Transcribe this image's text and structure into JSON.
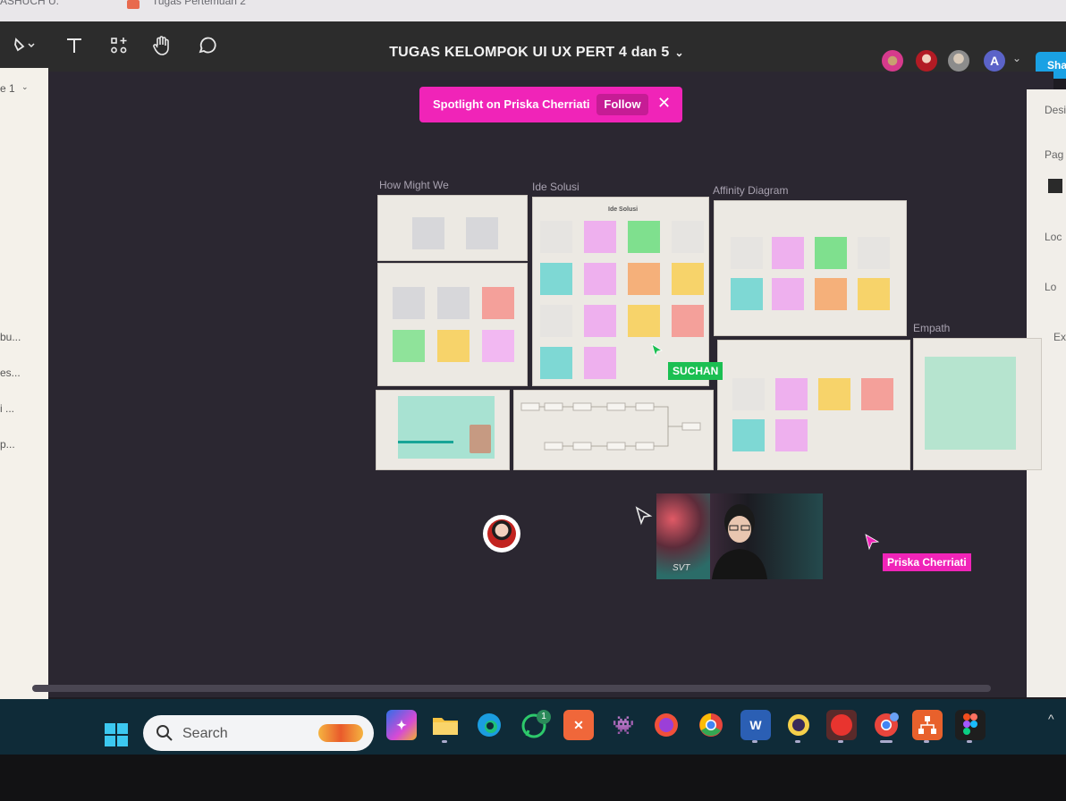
{
  "browser": {
    "tab_1": "ASHUCH U.",
    "tab_2": "Tugas Pertemuan 2"
  },
  "toolbar": {
    "file_title": "TUGAS KELOMPOK UI UX PERT 4 dan 5",
    "share_label": "Sha"
  },
  "left_panel": {
    "page_label": "e 1",
    "items": [
      "bu...",
      "es...",
      "i ...",
      "p..."
    ]
  },
  "right_panel": {
    "items": [
      "Desi",
      "Pag",
      "Loc",
      "Lo",
      "Ex"
    ]
  },
  "spotlight": {
    "label": "Spotlight on Priska Cherriati",
    "follow": "Follow"
  },
  "frames": {
    "how_might_we": "How Might We",
    "ide_solusi": "Ide Solusi",
    "ide_solusi_inner": "Ide Solusi",
    "affinity": "Affinity Diagram",
    "empath": "Empath"
  },
  "cursors": {
    "suchan": "SUCHAN",
    "priska": "Priska Cherriati"
  },
  "taskbar": {
    "search_label": "Search",
    "whatsapp_badge": "1"
  },
  "colors": {
    "spotlight": "#f024b8",
    "suchan_tag": "#1bbf52",
    "share": "#1aa1e4"
  }
}
